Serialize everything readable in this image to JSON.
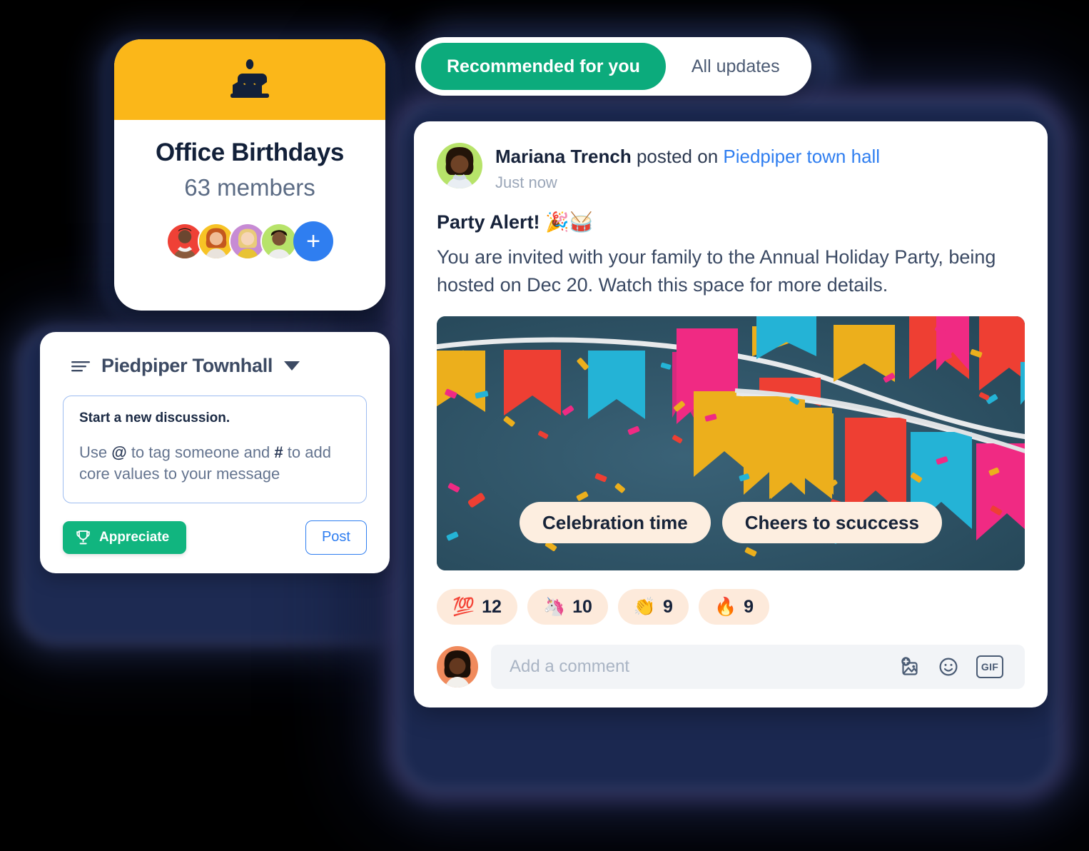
{
  "theme": {
    "accent_green": "#0CAB7C",
    "accent_blue": "#2F7EF0",
    "header_yellow": "#FBB719",
    "ink": "#16223A",
    "muted": "#64748F",
    "reaction_pill": "#FDEADB",
    "banner_bg": "#2C5265"
  },
  "tabs": {
    "items": [
      {
        "label": "Recommended for you",
        "active": true
      },
      {
        "label": "All updates",
        "active": false
      }
    ]
  },
  "birthday_card": {
    "icon": "birthday-cake-icon",
    "title": "Office Birthdays",
    "members_label": "63 members",
    "member_count": 63,
    "avatars": [
      {
        "name": "member-avatar-1",
        "bg": "#EF4136"
      },
      {
        "name": "member-avatar-2",
        "bg": "#F7C325"
      },
      {
        "name": "member-avatar-3",
        "bg": "#C78BD4"
      },
      {
        "name": "member-avatar-4",
        "bg": "#B7E36A"
      }
    ],
    "add_label": "+"
  },
  "composer": {
    "menu_icon": "hamburger-icon",
    "title": "Piedpiper Townhall",
    "caret_icon": "chevron-down-icon",
    "discussion_heading": "Start a new discussion.",
    "hint_prefix": "Use ",
    "hint_at": "@",
    "hint_mid": " to tag someone and ",
    "hint_hash": "#",
    "hint_suffix": " to add core values to your message",
    "appreciate_label": "Appreciate",
    "appreciate_icon": "trophy-icon",
    "post_label": "Post"
  },
  "post": {
    "author": "Mariana Trench",
    "author_avatar": "author-avatar",
    "posted_on": " posted on ",
    "space": "Piedpiper town hall",
    "timestamp": "Just now",
    "title": "Party Alert! 🎉🥁",
    "body": "You are invited with your family to the Annual Holiday Party, being hosted on Dec 20. Watch this space for more details.",
    "banner": {
      "alt": "party-bunting-banner",
      "buttons": [
        {
          "label": "Celebration time"
        },
        {
          "label": "Cheers to scuccess"
        }
      ]
    },
    "reactions": [
      {
        "emoji": "💯",
        "name": "reaction-hundred",
        "count": "12"
      },
      {
        "emoji": "🦄",
        "name": "reaction-unicorn",
        "count": "10"
      },
      {
        "emoji": "👏",
        "name": "reaction-clap",
        "count": "9"
      },
      {
        "emoji": "🔥",
        "name": "reaction-fire",
        "count": "9"
      }
    ],
    "comment": {
      "avatar": "current-user-avatar",
      "placeholder": "Add a comment",
      "value": "",
      "icons": [
        {
          "name": "add-image-icon"
        },
        {
          "name": "emoji-icon"
        },
        {
          "name": "gif-icon",
          "label": "GIF"
        }
      ]
    }
  }
}
